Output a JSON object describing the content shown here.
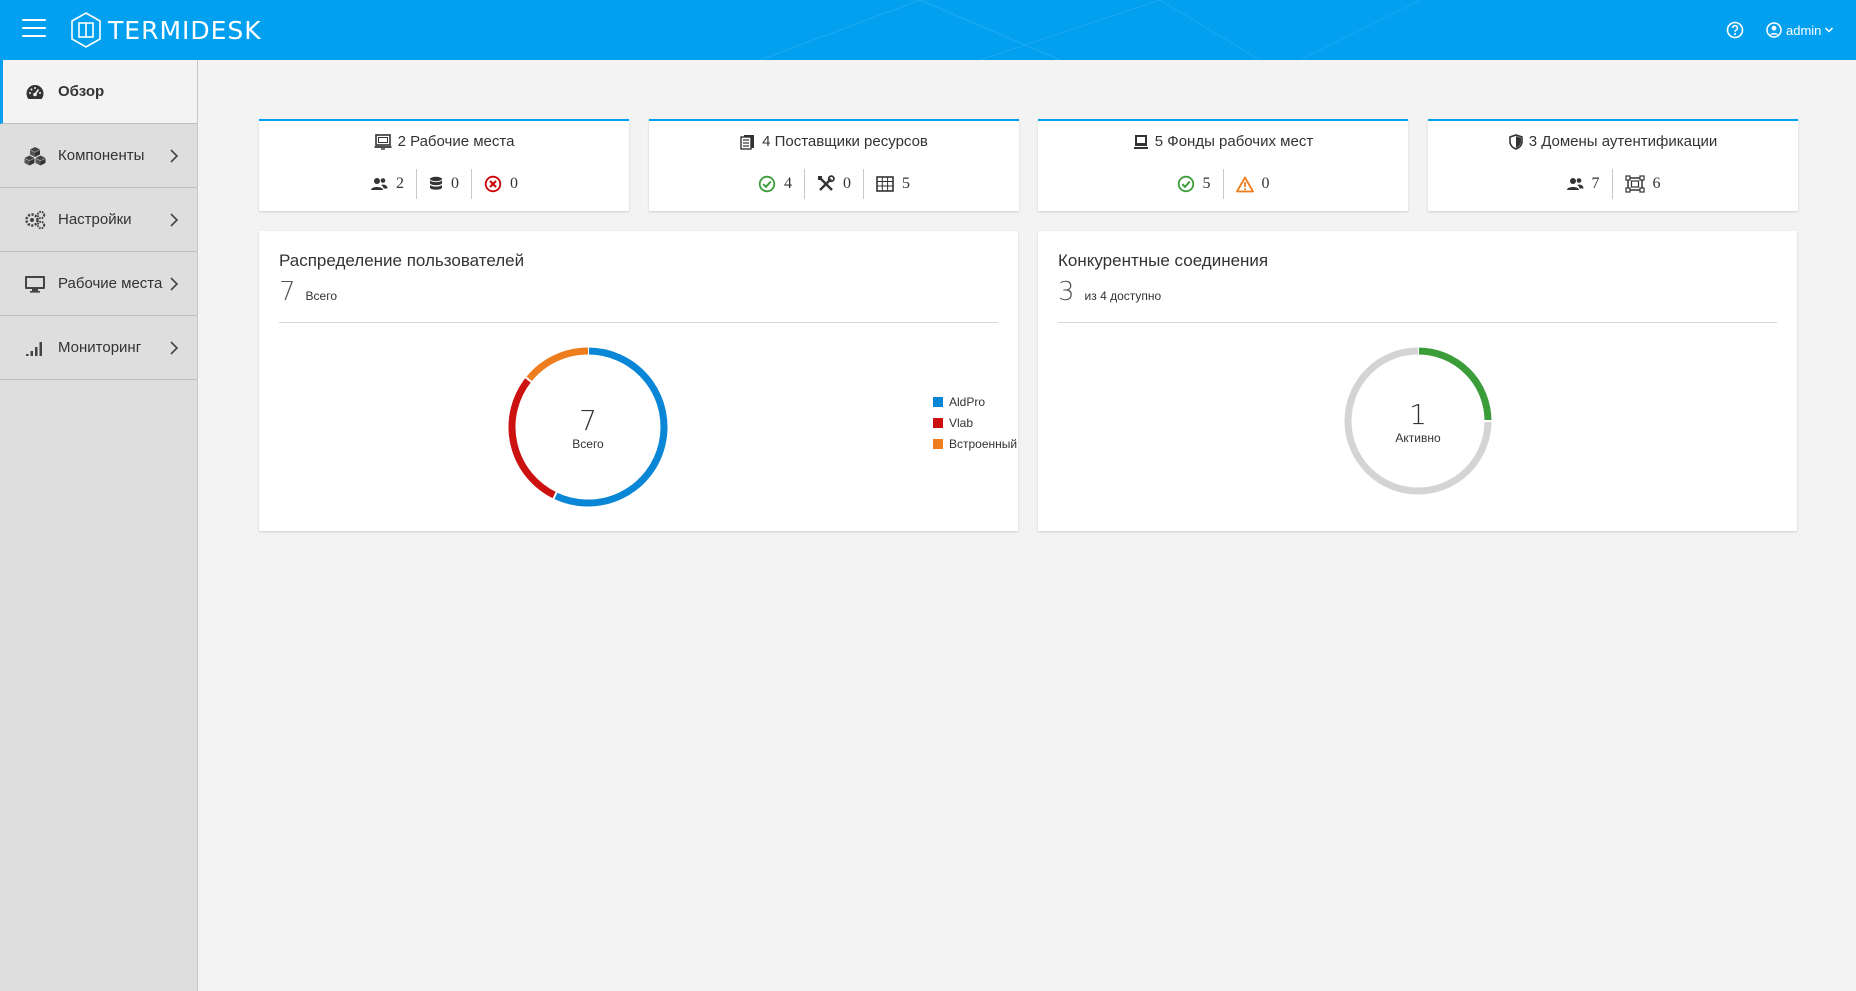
{
  "header": {
    "logo_text": "TERMIDESK",
    "user_name": "admin",
    "icons": [
      "menu-icon",
      "logo-icon",
      "help-icon",
      "user-icon",
      "chevron-down-icon"
    ]
  },
  "sidebar": {
    "items": [
      {
        "label": "Обзор",
        "icon": "dashboard-icon",
        "active": true
      },
      {
        "label": "Компоненты",
        "icon": "cubes-icon"
      },
      {
        "label": "Настройки",
        "icon": "gears-icon"
      },
      {
        "label": "Рабочие места",
        "icon": "monitor-icon"
      },
      {
        "label": "Мониторинг",
        "icon": "signal-bars-icon"
      }
    ]
  },
  "stats": [
    {
      "title": "2 Рабочие места",
      "icon": "desktop-icon",
      "items": [
        {
          "icon": "users-icon",
          "value": "2"
        },
        {
          "icon": "database-icon",
          "value": "0"
        },
        {
          "icon": "error-circle-icon",
          "value": "0",
          "color": "#cc0000"
        }
      ]
    },
    {
      "title": "4 Поставщики ресурсов",
      "icon": "servers-icon",
      "items": [
        {
          "icon": "check-circle-icon",
          "value": "4",
          "color": "#3a9d3a"
        },
        {
          "icon": "tools-icon",
          "value": "0"
        },
        {
          "icon": "grid-icon",
          "value": "5"
        }
      ]
    },
    {
      "title": "5 Фонды рабочих мест",
      "icon": "pool-icon",
      "items": [
        {
          "icon": "check-circle-icon",
          "value": "5",
          "color": "#3a9d3a"
        },
        {
          "icon": "warning-icon",
          "value": "0",
          "color": "#ee7d1d"
        }
      ]
    },
    {
      "title": "3 Домены аутентификации",
      "icon": "shield-icon",
      "items": [
        {
          "icon": "users-icon",
          "value": "7"
        },
        {
          "icon": "group-frame-icon",
          "value": "6"
        }
      ]
    }
  ],
  "users_panel": {
    "title": "Распределение пользователей",
    "total": "7",
    "total_label": "Всего",
    "center_value": "7",
    "center_label": "Всего"
  },
  "connections_panel": {
    "title": "Конкурентные соединения",
    "total": "3",
    "total_label": "из 4 доступно",
    "center_value": "1",
    "center_label": "Активно"
  },
  "chart_data": [
    {
      "type": "pie",
      "title": "Распределение пользователей",
      "categories": [
        "AldPro",
        "Vlab",
        "Встроенный"
      ],
      "values": [
        4,
        2,
        1
      ],
      "colors": [
        "#0a86d6",
        "#cc1111",
        "#ee7d1d"
      ],
      "legend": "right"
    },
    {
      "type": "pie",
      "title": "Конкурентные соединения",
      "categories": [
        "Активно",
        ""
      ],
      "values": [
        1,
        3
      ],
      "colors": [
        "#3a9d3a",
        "#d4d4d4"
      ]
    }
  ]
}
